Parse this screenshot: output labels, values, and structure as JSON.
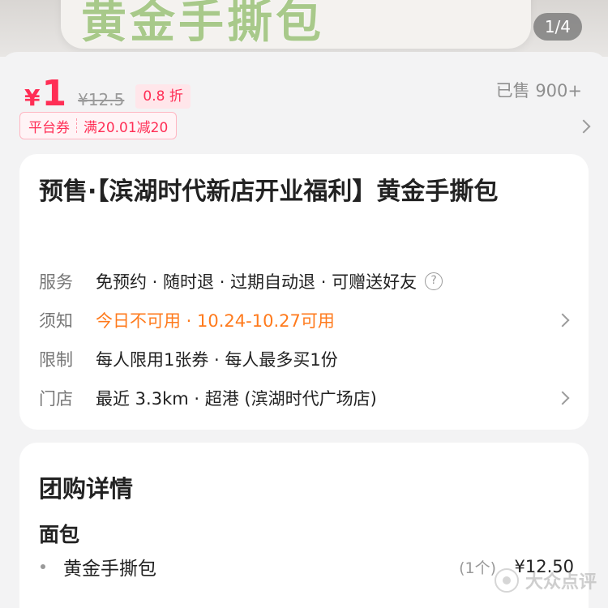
{
  "banner": {
    "title": "黄金手撕包",
    "image_counter": "1/4"
  },
  "price": {
    "symbol": "¥",
    "current": "1",
    "original": "¥12.5",
    "discount": "0.8 折",
    "sold": "已售 900+"
  },
  "coupon": {
    "type": "平台券",
    "rule": "满20.01减20"
  },
  "deal": {
    "title": "预售·【滨湖时代新店开业福利】黄金手撕包",
    "rows": [
      {
        "label": "服务",
        "value": "免预约 · 随时退 · 过期自动退 · 可赠送好友"
      },
      {
        "label": "须知",
        "value": "今日不可用 · 10.24-10.27可用"
      },
      {
        "label": "限制",
        "value": "每人限用1张券 · 每人最多买1份"
      },
      {
        "label": "门店",
        "value": "最近 3.3km · 超港 (滨湖时代广场店)"
      }
    ]
  },
  "details": {
    "heading": "团购详情",
    "section": "面包",
    "items": [
      {
        "name": "黄金手撕包",
        "qty": "(1个)",
        "price": "¥12.50"
      }
    ]
  },
  "watermark": "大众点评",
  "colors": {
    "accent": "#ff2e55",
    "notice": "#ff7a1c",
    "banner_text": "#a8c98a"
  }
}
